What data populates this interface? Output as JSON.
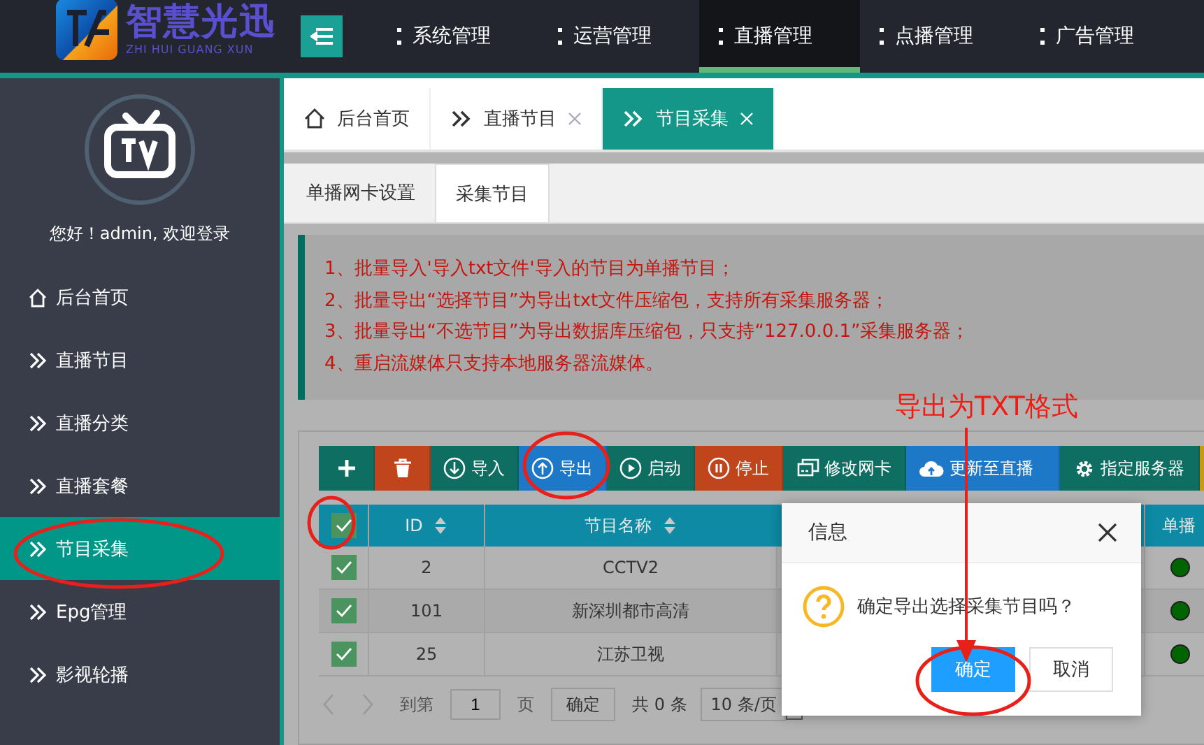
{
  "logo": {
    "title": "智慧光迅",
    "subtitle": "ZHI HUI GUANG XUN"
  },
  "top_nav": [
    {
      "label": "系统管理",
      "selected": false
    },
    {
      "label": "运营管理",
      "selected": false
    },
    {
      "label": "直播管理",
      "selected": true
    },
    {
      "label": "点播管理",
      "selected": false
    },
    {
      "label": "广告管理",
      "selected": false
    }
  ],
  "sidebar": {
    "greeting": "您好！admin, 欢迎登录",
    "items": [
      {
        "label": "后台首页",
        "kind": "home",
        "selected": false
      },
      {
        "label": "直播节目",
        "kind": "link",
        "selected": false
      },
      {
        "label": "直播分类",
        "kind": "link",
        "selected": false
      },
      {
        "label": "直播套餐",
        "kind": "link",
        "selected": false
      },
      {
        "label": "节目采集",
        "kind": "link",
        "selected": true
      },
      {
        "label": "Epg管理",
        "kind": "link",
        "selected": false
      },
      {
        "label": "影视轮播",
        "kind": "link",
        "selected": false
      }
    ]
  },
  "tabs": [
    {
      "label": "后台首页",
      "kind": "home",
      "selected": false
    },
    {
      "label": "直播节目",
      "kind": "page",
      "selected": false
    },
    {
      "label": "节目采集",
      "kind": "page",
      "selected": true
    }
  ],
  "sub_tabs": [
    {
      "label": "单播网卡设置",
      "selected": false
    },
    {
      "label": "采集节目",
      "selected": true
    }
  ],
  "notice": [
    "1、批量导入'导入txt文件'导入的节目为单播节目；",
    "2、批量导出“选择节目”为导出txt文件压缩包，支持所有采集服务器；",
    "3、批量导出“不选节目”为导出数据库压缩包，只支持“127.0.0.1”采集服务器；",
    "4、重启流媒体只支持本地服务器流媒体。"
  ],
  "toolbar": [
    {
      "kind": "add",
      "color": "#0f6e62"
    },
    {
      "kind": "delete",
      "color": "#c0441c"
    },
    {
      "kind": "import",
      "label": "导入",
      "color": "#0f6e62"
    },
    {
      "kind": "export",
      "label": "导出",
      "color": "#1e78c8"
    },
    {
      "kind": "start",
      "label": "启动",
      "color": "#0f6e62"
    },
    {
      "kind": "stop",
      "label": "停止",
      "color": "#c0441c"
    },
    {
      "kind": "nic",
      "label": "修改网卡",
      "color": "#0f6e62"
    },
    {
      "kind": "cloud",
      "label": "更新至直播",
      "color": "#1e78c8"
    },
    {
      "kind": "gear",
      "label": "指定服务器",
      "color": "#0f6e62"
    },
    {
      "kind": "partial",
      "color": "#c89a10"
    }
  ],
  "table": {
    "all_checked": true,
    "columns": [
      {
        "label": "ID",
        "sortable": true
      },
      {
        "label": "节目名称",
        "sortable": true
      },
      {
        "label": "单播"
      }
    ],
    "rows": [
      {
        "checked": true,
        "id": "2",
        "name": "CCTV2",
        "on": true
      },
      {
        "checked": true,
        "id": "101",
        "name": "新深圳都市高清",
        "on": true
      },
      {
        "checked": true,
        "id": "25",
        "name": "江苏卫视",
        "on": true
      }
    ]
  },
  "pagination": {
    "go_to": "到第",
    "page": "1",
    "page_unit": "页",
    "confirm": "确定",
    "total": "共 0 条",
    "page_size": "10 条/页"
  },
  "dialog": {
    "title": "信息",
    "message": "确定导出选择采集节目吗？",
    "confirm": "确定",
    "cancel": "取消"
  },
  "annotation": "导出为TXT格式"
}
